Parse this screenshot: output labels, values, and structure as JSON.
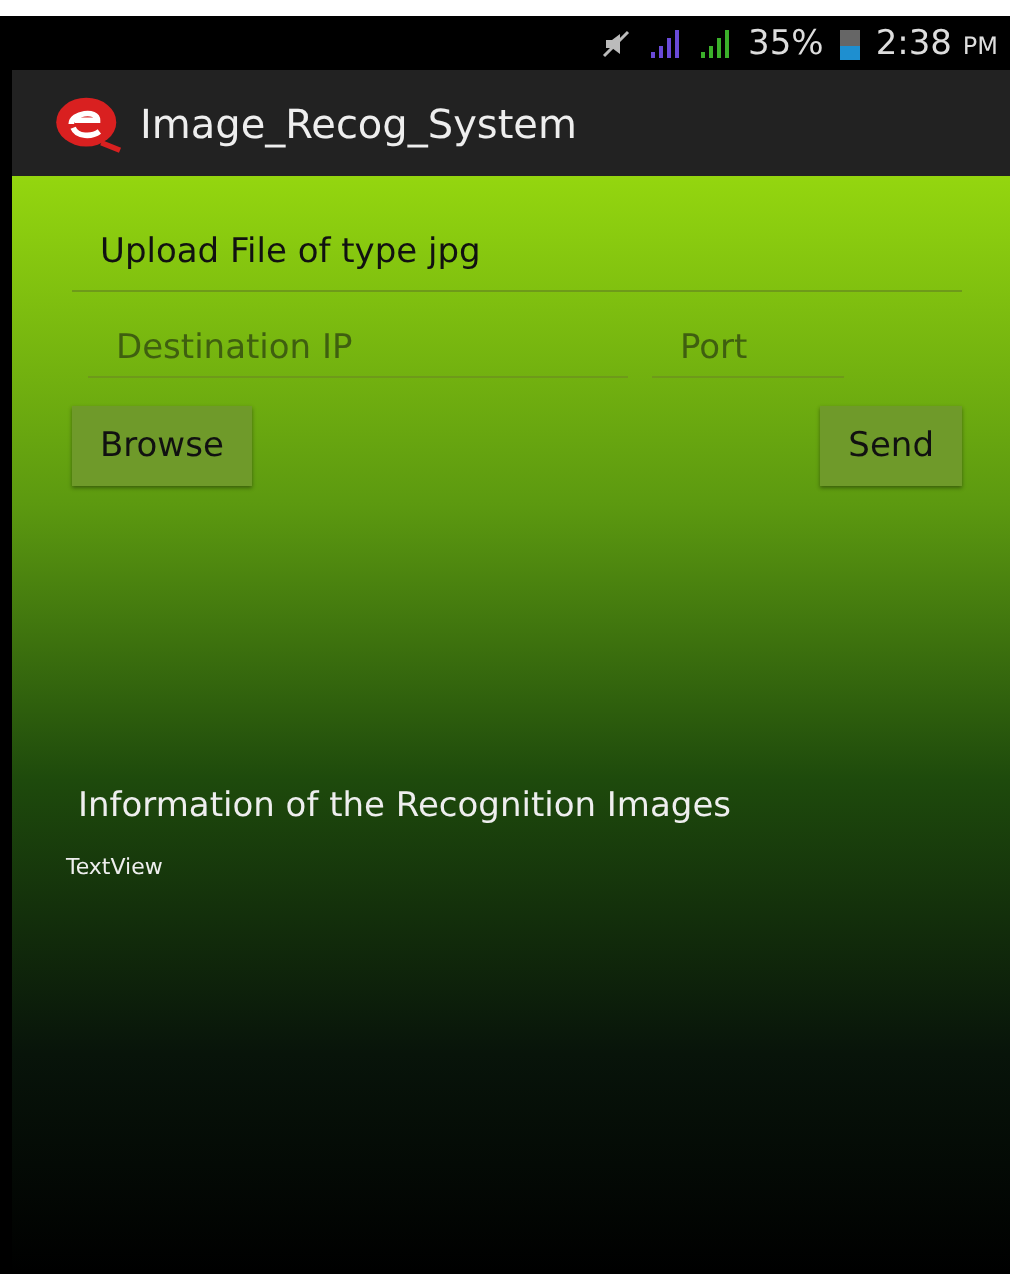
{
  "status_bar": {
    "battery": "35%",
    "time": "2:38",
    "meridiem": "PM"
  },
  "action_bar": {
    "title": "Image_Recog_System"
  },
  "upload_field": {
    "value": "Upload File of type jpg"
  },
  "destination_field": {
    "placeholder": "Destination IP"
  },
  "port_field": {
    "placeholder": "Port"
  },
  "buttons": [
    {
      "label": "Browse"
    },
    {
      "label": "Send"
    }
  ],
  "info_heading": "Information of the Recognition Images",
  "info_text": "TextView"
}
